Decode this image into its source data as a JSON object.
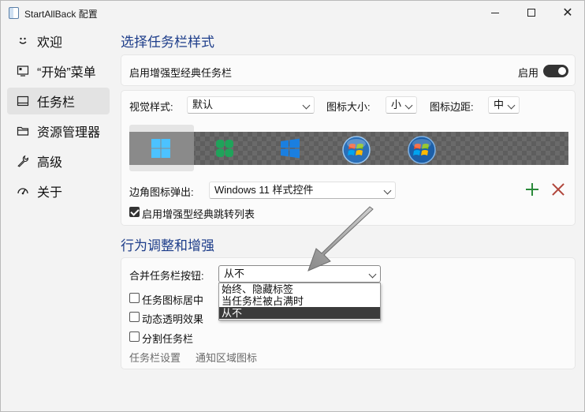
{
  "window": {
    "title": "StartAllBack 配置"
  },
  "sidebar": {
    "items": [
      {
        "label": "欢迎",
        "icon": "smile-icon"
      },
      {
        "label": "“开始”菜单",
        "icon": "start-menu-icon"
      },
      {
        "label": "任务栏",
        "icon": "taskbar-icon",
        "active": true
      },
      {
        "label": "资源管理器",
        "icon": "folder-icon"
      },
      {
        "label": "高级",
        "icon": "wrench-icon"
      },
      {
        "label": "关于",
        "icon": "gauge-icon"
      }
    ]
  },
  "taskbar_style": {
    "section_title": "选择任务栏样式",
    "enhanced_classic_label": "启用增强型经典任务栏",
    "enable_label": "启用",
    "enable_state": true,
    "visual_style_label": "视觉样式:",
    "visual_style_value": "默认",
    "icon_size_label": "图标大小:",
    "icon_size_value": "小",
    "icon_margin_label": "图标边距:",
    "icon_margin_value": "中",
    "style_options": [
      "windows-11-icon",
      "windows-vista-icon",
      "windows-10-icon",
      "windows-7-orb-icon",
      "windows-xp-orb-icon"
    ],
    "corner_icon_label": "边角图标弹出:",
    "corner_icon_value": "Windows 11 样式控件",
    "jumplist_label": "启用增强型经典跳转列表",
    "jumplist_checked": true
  },
  "behavior": {
    "section_title": "行为调整和增强",
    "combine_label": "合并任务栏按钮:",
    "combine_value": "从不",
    "combine_options": [
      "始终、隐藏标签",
      "当任务栏被占满时",
      "从不"
    ],
    "center_icons_label": "任务图标居中",
    "dynamic_transparency_label": "动态透明效果",
    "split_taskbar_label": "分割任务栏",
    "taskbar_settings_link": "任务栏设置",
    "notification_icons_link": "通知区域图标"
  },
  "colors": {
    "accent_title": "#1d3d8a",
    "add_green": "#2a8a3a",
    "remove_red": "#b0453a"
  }
}
